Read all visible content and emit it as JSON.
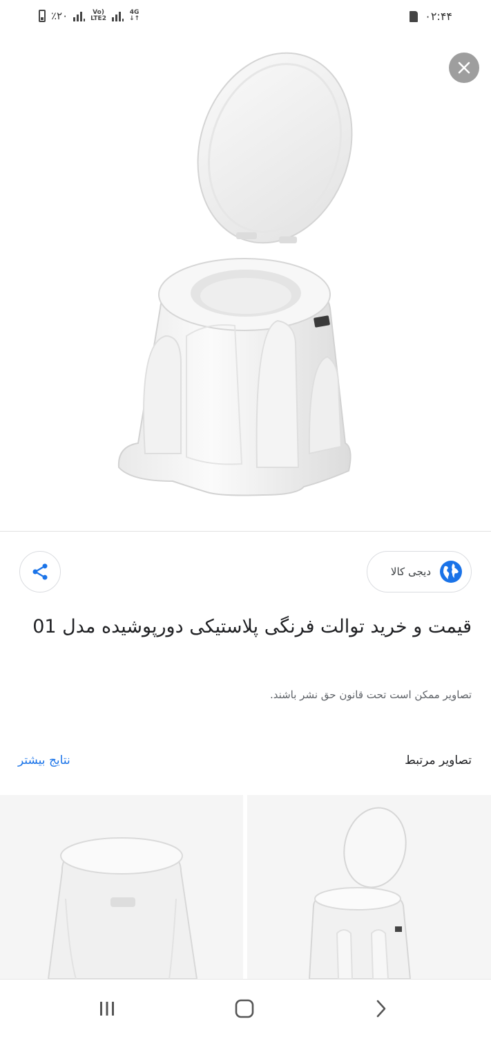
{
  "status_bar": {
    "battery_text": "٪۲۰",
    "network_volte": "Vo)",
    "network_lte": "LTE2",
    "network_4g": "4G",
    "time": "۰۲:۴۴"
  },
  "close_icon": "close-icon",
  "source": {
    "name": "دیجی کالا",
    "icon": "globe-icon"
  },
  "share_icon": "share-icon",
  "title": "قیمت و خرید توالت فرنگی پلاستیکی دورپوشیده مدل 01",
  "copyright_notice": "تصاویر ممکن است تحت قانون حق نشر باشند.",
  "related": {
    "heading": "تصاویر مرتبط",
    "more_results": "نتایج بیشتر"
  },
  "nav": {
    "recents_icon": "recents-icon",
    "home_icon": "home-icon",
    "back_icon": "chevron-right-icon"
  },
  "colors": {
    "accent_link": "#1a73e8",
    "globe": "#1a73e8",
    "close_button_bg": "#9e9e9e"
  }
}
